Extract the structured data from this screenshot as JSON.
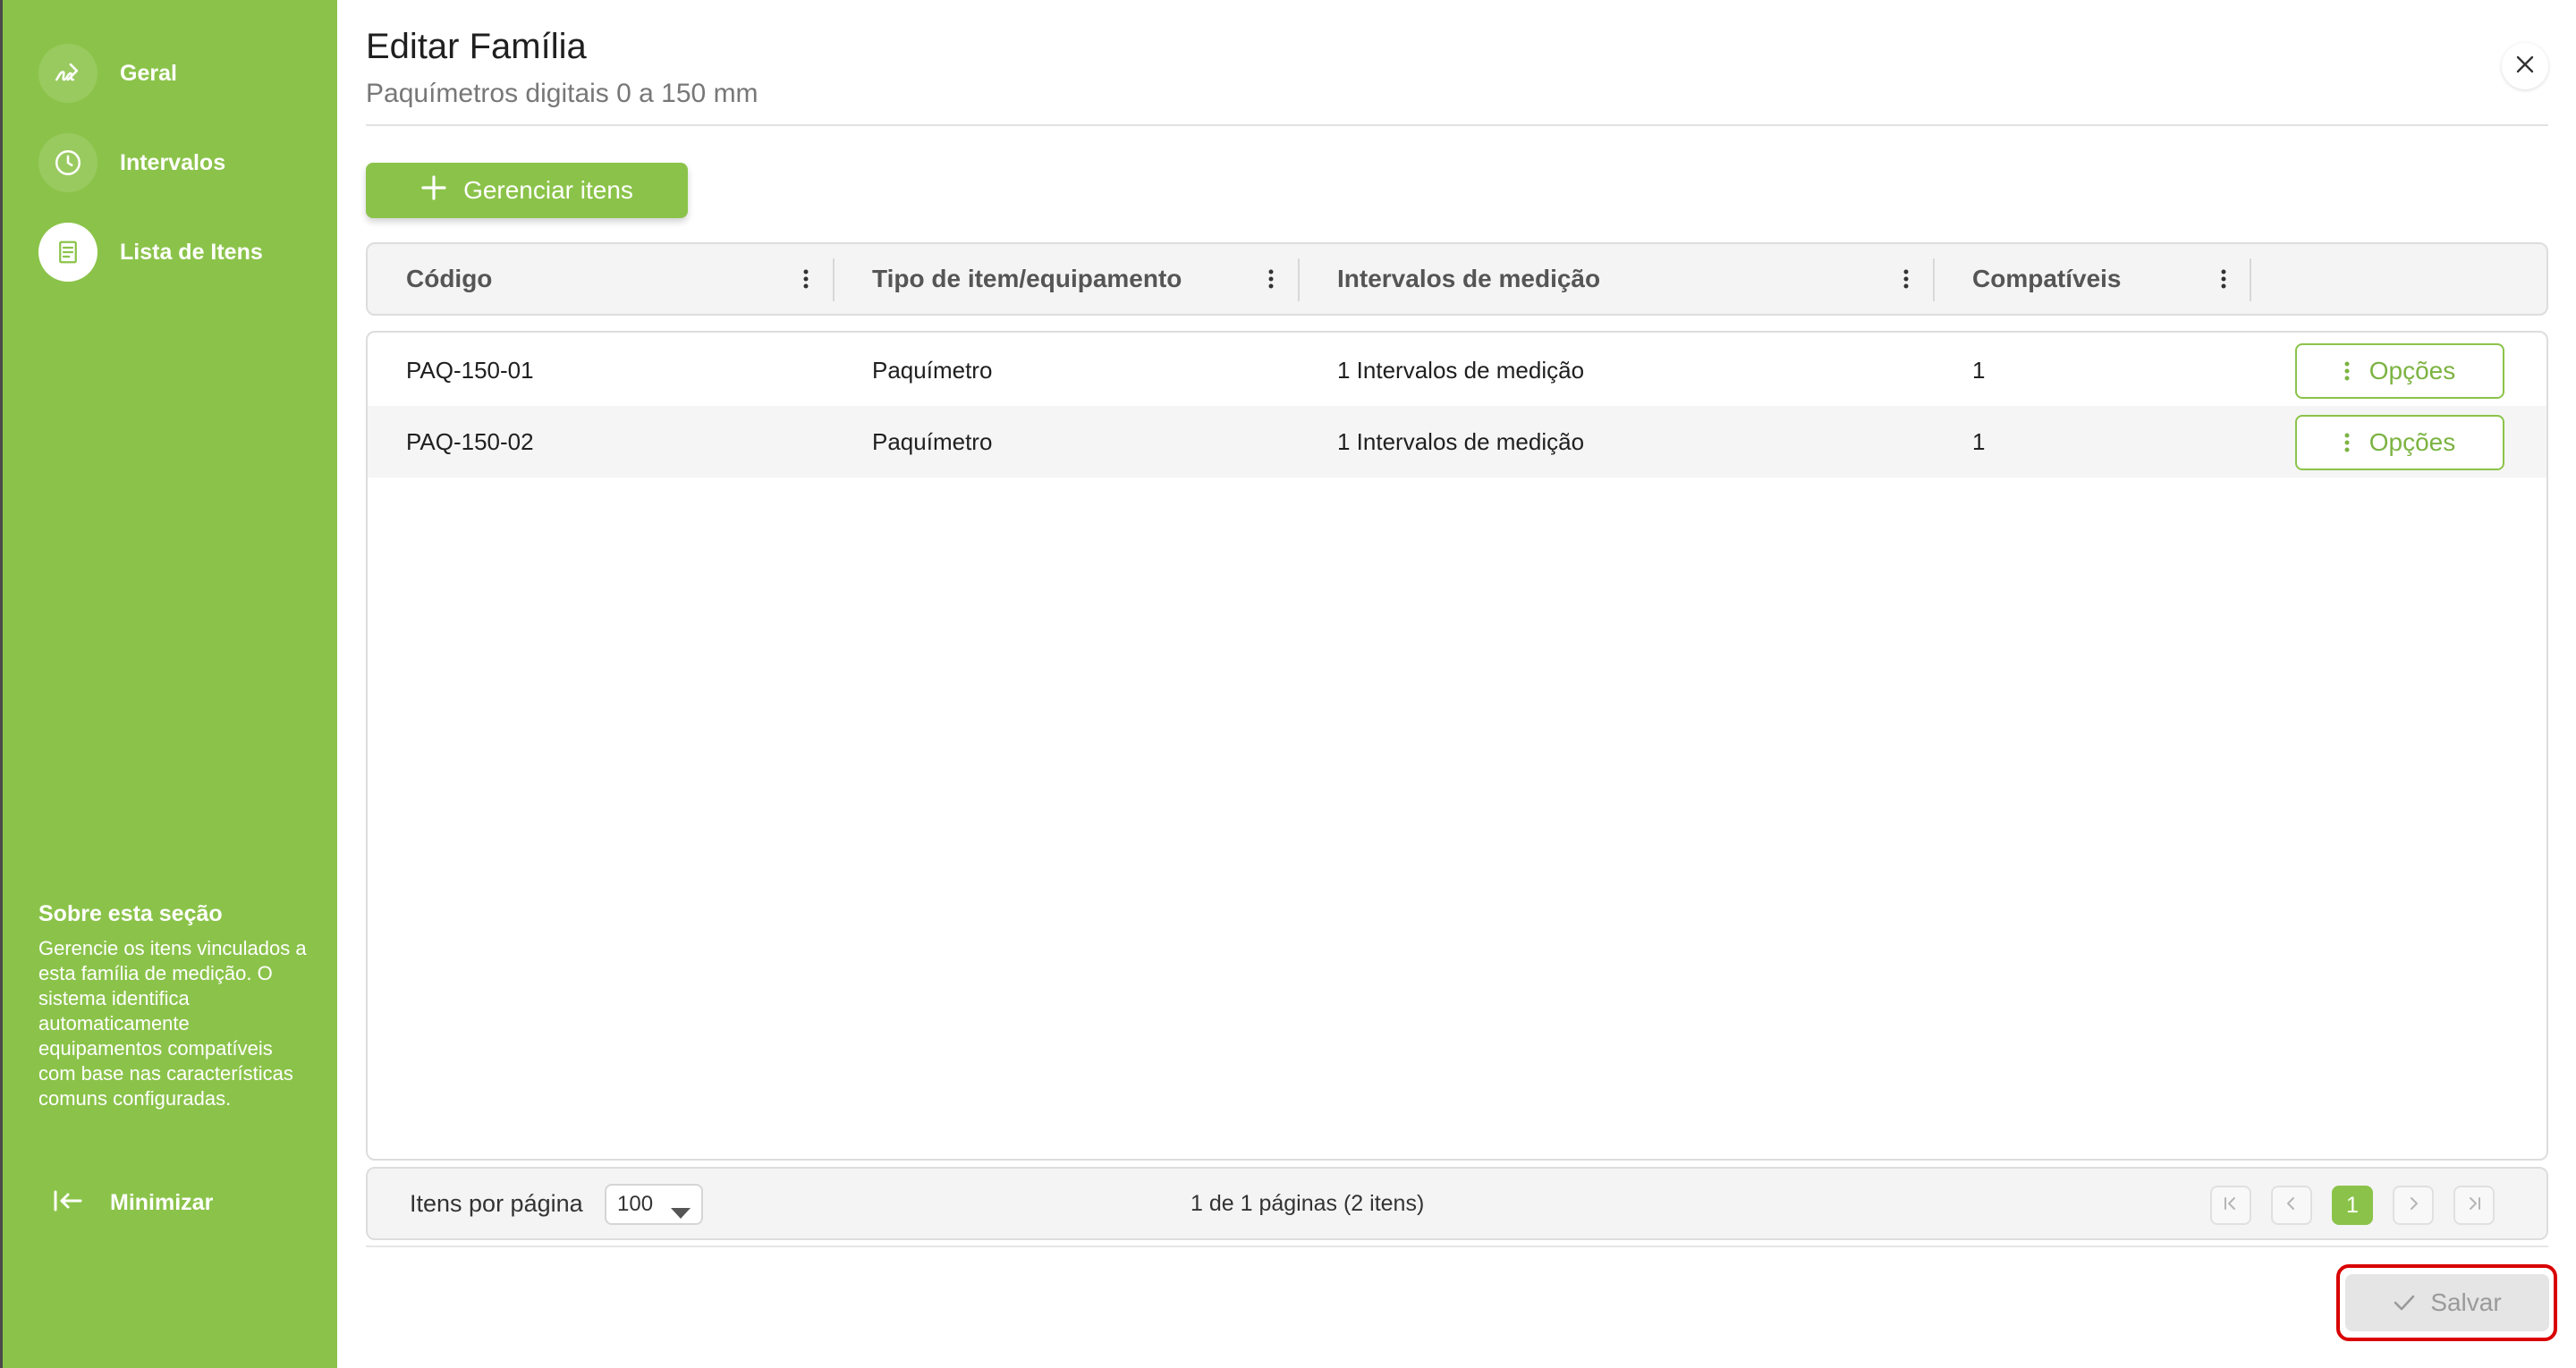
{
  "sidebar": {
    "items": [
      {
        "label": "Geral",
        "icon": "signature-icon"
      },
      {
        "label": "Intervalos",
        "icon": "clock-icon"
      },
      {
        "label": "Lista de Itens",
        "icon": "list-icon"
      }
    ],
    "about_title": "Sobre esta seção",
    "about_text": "Gerencie os itens vinculados a esta família de medição. O sistema identifica automaticamente equipamentos compatíveis com base nas características comuns configuradas.",
    "minimize_label": "Minimizar"
  },
  "header": {
    "title": "Editar Família",
    "subtitle": "Paquímetros digitais 0 a 150 mm"
  },
  "toolbar": {
    "manage_label": "Gerenciar itens"
  },
  "table": {
    "columns": [
      "Código",
      "Tipo de item/equipamento",
      "Intervalos de medição",
      "Compatíveis"
    ],
    "rows": [
      {
        "codigo": "PAQ-150-01",
        "tipo": "Paquímetro",
        "intervalos": "1 Intervalos de medição",
        "compativeis": "1",
        "action": "Opções"
      },
      {
        "codigo": "PAQ-150-02",
        "tipo": "Paquímetro",
        "intervalos": "1 Intervalos de medição",
        "compativeis": "1",
        "action": "Opções"
      }
    ]
  },
  "pagination": {
    "per_page_label": "Itens por página",
    "per_page_value": "100",
    "info": "1 de 1 páginas (2 itens)",
    "current_page": "1"
  },
  "footer": {
    "save_label": "Salvar"
  },
  "colors": {
    "accent": "#8bc34a",
    "highlight_border": "#d90000"
  }
}
